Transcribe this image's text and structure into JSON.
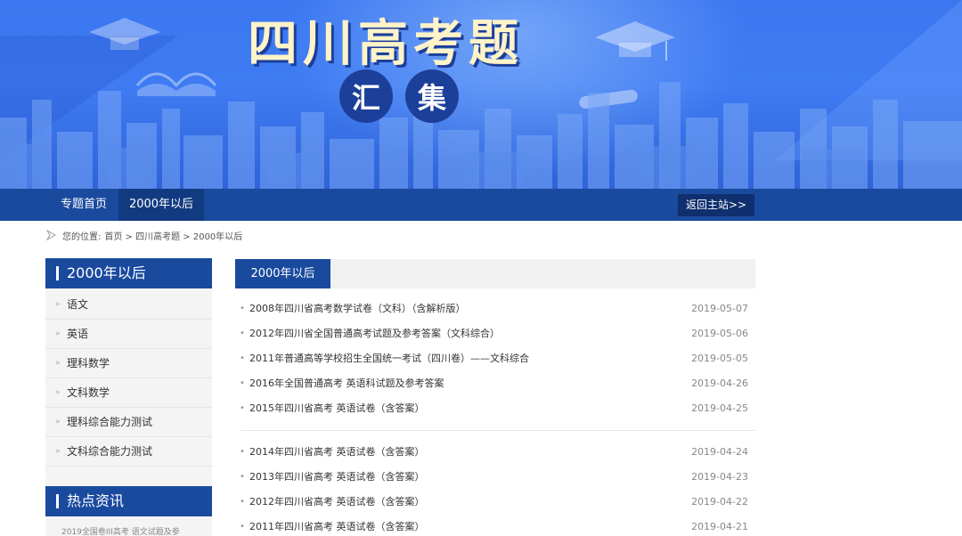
{
  "banner": {
    "title": "四川高考题",
    "sub": [
      "汇",
      "集"
    ]
  },
  "nav": {
    "home": "专题首页",
    "active": "2000年以后",
    "back": "返回主站>>"
  },
  "breadcrumb": {
    "label": "您的位置:",
    "path": "首页 > 四川高考题 > 2000年以后"
  },
  "sidebar": {
    "heading": "2000年以后",
    "items": [
      "语文",
      "英语",
      "理科数学",
      "文科数学",
      "理科综合能力测试",
      "文科综合能力测试"
    ],
    "hot_heading": "热点资讯",
    "hot_item": "2019全国卷III高考 语文试题及参"
  },
  "main": {
    "tab": "2000年以后",
    "group1": [
      {
        "title": "2008年四川省高考数学试卷（文科）（含解析版）",
        "date": "2019-05-07"
      },
      {
        "title": "2012年四川省全国普通高考试题及参考答案（文科综合）",
        "date": "2019-05-06"
      },
      {
        "title": "2011年普通高等学校招生全国统一考试（四川卷）——文科综合",
        "date": "2019-05-05"
      },
      {
        "title": "2016年全国普通高考 英语科试题及参考答案",
        "date": "2019-04-26"
      },
      {
        "title": "2015年四川省高考 英语试卷（含答案）",
        "date": "2019-04-25"
      }
    ],
    "group2": [
      {
        "title": "2014年四川省高考 英语试卷（含答案）",
        "date": "2019-04-24"
      },
      {
        "title": "2013年四川省高考 英语试卷（含答案）",
        "date": "2019-04-23"
      },
      {
        "title": "2012年四川省高考 英语试卷（含答案）",
        "date": "2019-04-22"
      },
      {
        "title": "2011年四川省高考 英语试卷（含答案）",
        "date": "2019-04-21"
      }
    ]
  },
  "colors": {
    "nav": "#1a4a9e",
    "banner": "#3b77f0"
  }
}
